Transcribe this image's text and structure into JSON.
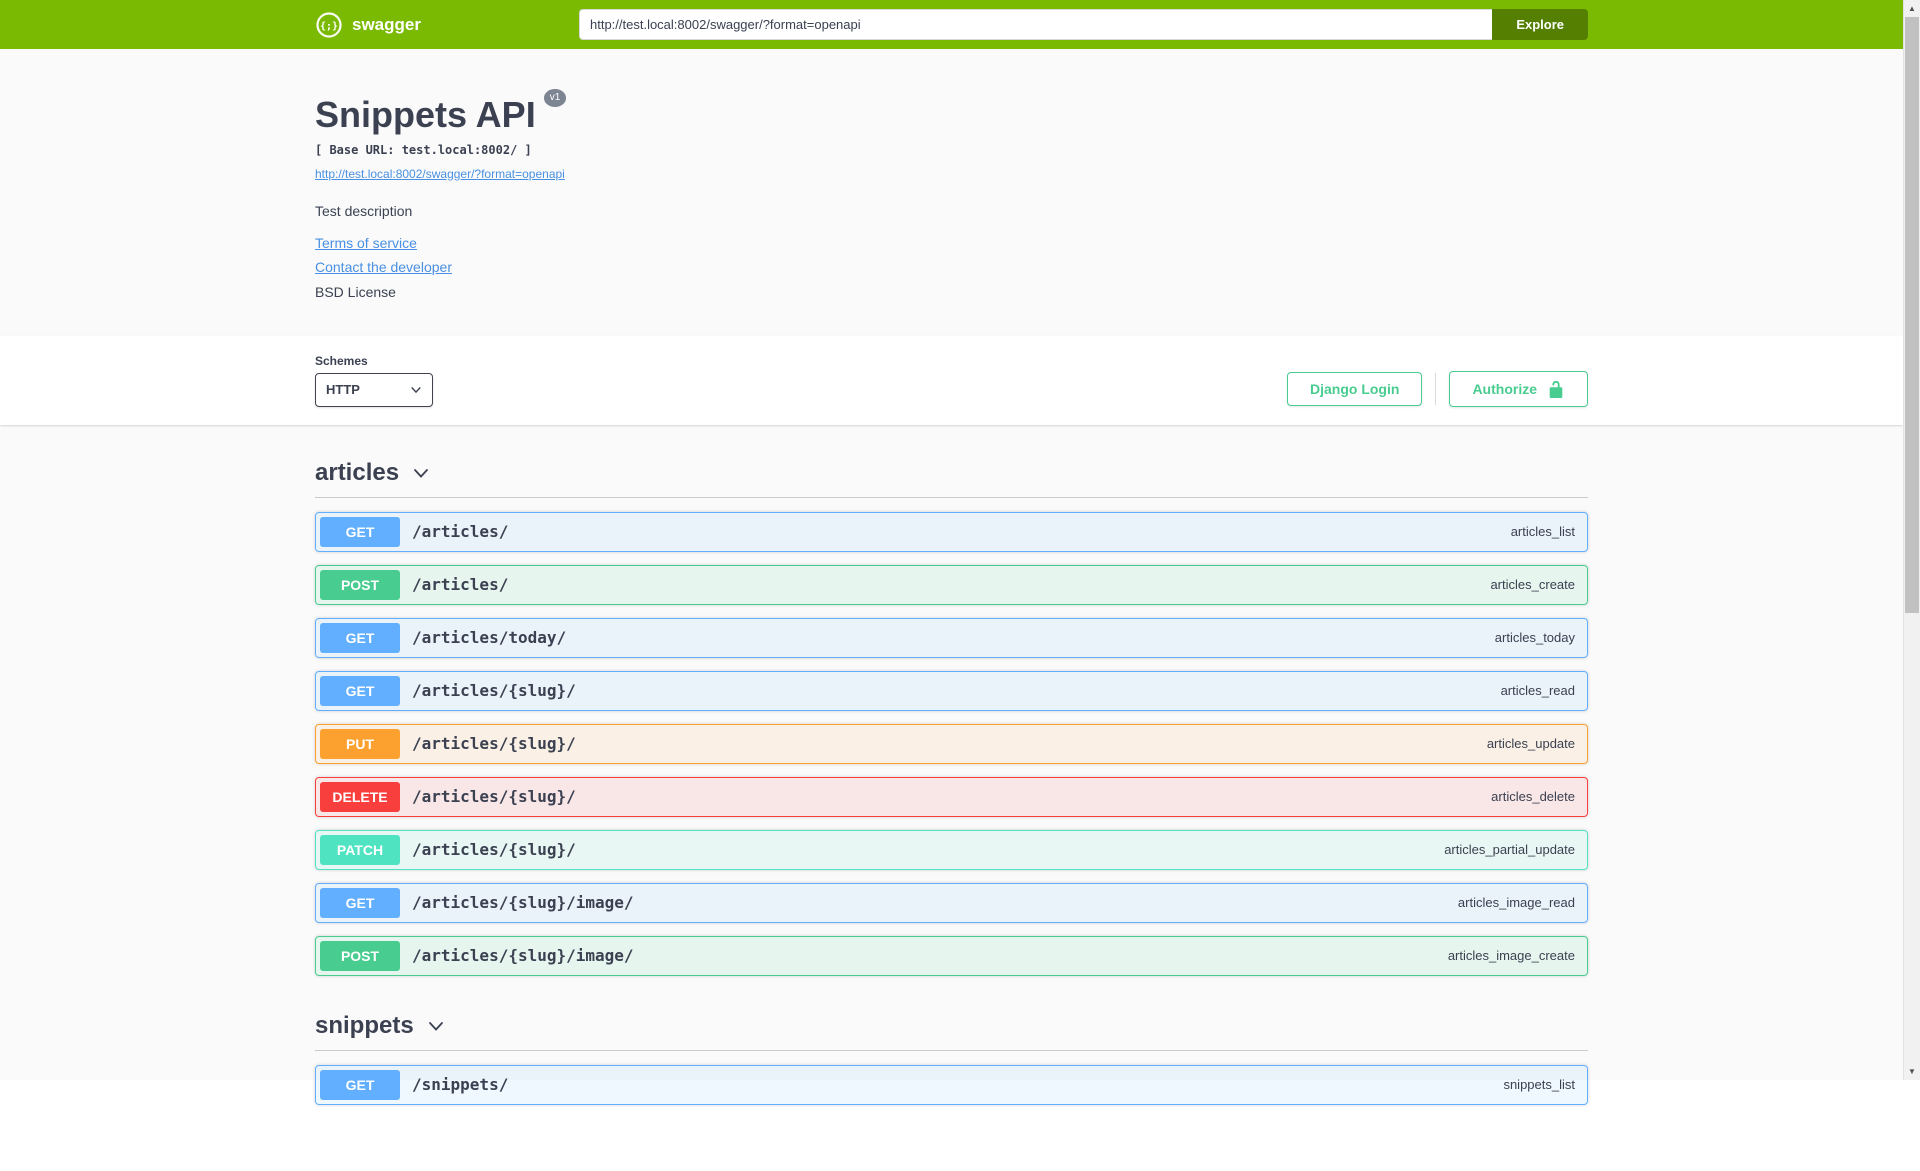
{
  "topbar": {
    "brand": "swagger",
    "url_value": "http://test.local:8002/swagger/?format=openapi",
    "explore_label": "Explore"
  },
  "info": {
    "title": "Snippets API",
    "version_badge": "v1",
    "base_url": "[ Base URL: test.local:8002/ ]",
    "spec_link": "http://test.local:8002/swagger/?format=openapi",
    "description": "Test description",
    "terms_link": "Terms of service",
    "contact_link": "Contact the developer",
    "license": "BSD License"
  },
  "scheme": {
    "label": "Schemes",
    "selected": "HTTP",
    "django_login_label": "Django Login",
    "authorize_label": "Authorize"
  },
  "colors": {
    "topbar_green": "#7aba03",
    "explore_green": "#547f00",
    "link_blue": "#4990e2",
    "text": "#3b4151",
    "version_badge_gray": "#7d8492",
    "authorize_green": "#49cc90",
    "GET": "#61affe",
    "POST": "#49cc90",
    "PUT": "#fca130",
    "DELETE": "#f93e3e",
    "PATCH": "#50e3c2"
  },
  "sections": [
    {
      "name": "articles",
      "operations": [
        {
          "method": "GET",
          "path": "/articles/",
          "op_id": "articles_list"
        },
        {
          "method": "POST",
          "path": "/articles/",
          "op_id": "articles_create"
        },
        {
          "method": "GET",
          "path": "/articles/today/",
          "op_id": "articles_today"
        },
        {
          "method": "GET",
          "path": "/articles/{slug}/",
          "op_id": "articles_read"
        },
        {
          "method": "PUT",
          "path": "/articles/{slug}/",
          "op_id": "articles_update"
        },
        {
          "method": "DELETE",
          "path": "/articles/{slug}/",
          "op_id": "articles_delete"
        },
        {
          "method": "PATCH",
          "path": "/articles/{slug}/",
          "op_id": "articles_partial_update"
        },
        {
          "method": "GET",
          "path": "/articles/{slug}/image/",
          "op_id": "articles_image_read"
        },
        {
          "method": "POST",
          "path": "/articles/{slug}/image/",
          "op_id": "articles_image_create"
        }
      ]
    },
    {
      "name": "snippets",
      "operations": [
        {
          "method": "GET",
          "path": "/snippets/",
          "op_id": "snippets_list"
        }
      ]
    }
  ]
}
